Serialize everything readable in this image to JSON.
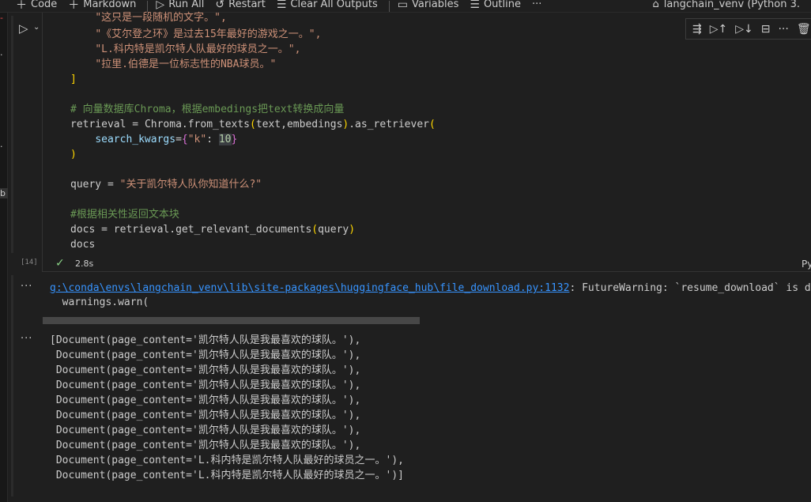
{
  "toolbar": {
    "code": "Code",
    "markdown": "Markdown",
    "run_all": "Run All",
    "restart": "Restart",
    "clear_all": "Clear All Outputs",
    "variables": "Variables",
    "outline": "Outline",
    "more": "···",
    "kernel": "langchain_venv (Python 3."
  },
  "cell": {
    "code_lines": [
      {
        "kind": "str",
        "indent": "    ",
        "text": "\"这只是一段随机的文字。\","
      },
      {
        "kind": "str",
        "indent": "    ",
        "text": "\"《艾尔登之环》是过去15年最好的游戏之一。\","
      },
      {
        "kind": "str",
        "indent": "    ",
        "text": "\"L.科内特是凯尔特人队最好的球员之一。\","
      },
      {
        "kind": "str",
        "indent": "    ",
        "text": "\"拉里.伯德是一位标志性的NBA球员。\""
      }
    ],
    "close_bracket": "]",
    "comment1": "# 向量数据库Chroma，根据embedings把text转换成向量",
    "retrieval_var": "retrieval",
    "eq": " = ",
    "chroma": "Chroma",
    "from_texts": ".from_texts",
    "args": "text,embedings",
    "as_retriever": ".as_retriever",
    "kw": "search_kwargs",
    "key": "\"k\"",
    "k_value": "10",
    "query_var": "query",
    "query_str": "\"关于凯尔特人队你知道什么?\"",
    "comment2": "#根据相关性返回文本块",
    "docs_var": "docs",
    "get_docs": "get_relevant_documents",
    "docs_line": "docs",
    "exec_count": "[14]",
    "duration": "2.8s",
    "language": "Py"
  },
  "output": {
    "dots": "···",
    "warning_link": "g:\\conda\\envs\\langchain_venv\\lib\\site-packages\\huggingface_hub\\file_download.py:1132",
    "warning_text": ": FutureWarning: `resume_download` is dep",
    "warn_line": "  warnings.warn(",
    "result_lines": [
      "[Document(page_content='凯尔特人队是我最喜欢的球队。'),",
      " Document(page_content='凯尔特人队是我最喜欢的球队。'),",
      " Document(page_content='凯尔特人队是我最喜欢的球队。'),",
      " Document(page_content='凯尔特人队是我最喜欢的球队。'),",
      " Document(page_content='凯尔特人队是我最喜欢的球队。'),",
      " Document(page_content='凯尔特人队是我最喜欢的球队。'),",
      " Document(page_content='凯尔特人队是我最喜欢的球队。'),",
      " Document(page_content='凯尔特人队是我最喜欢的球队。'),",
      " Document(page_content='L.科内特是凯尔特人队最好的球员之一。'),",
      " Document(page_content='L.科内特是凯尔特人队最好的球员之一。')]"
    ]
  }
}
